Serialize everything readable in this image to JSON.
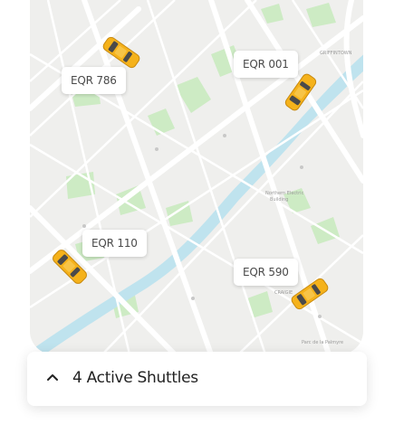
{
  "map": {
    "vehicles": [
      {
        "id": "EQR 786"
      },
      {
        "id": "EQR 001"
      },
      {
        "id": "EQR 110"
      },
      {
        "id": "EQR 590"
      }
    ],
    "colors": {
      "water": "#bfe3ee",
      "park": "#cdebc4",
      "road": "#ffffff",
      "vehicle": "#f5b21b"
    }
  },
  "panel": {
    "title": "4 Active Shuttles",
    "expand_icon": "chevron-up-icon"
  }
}
